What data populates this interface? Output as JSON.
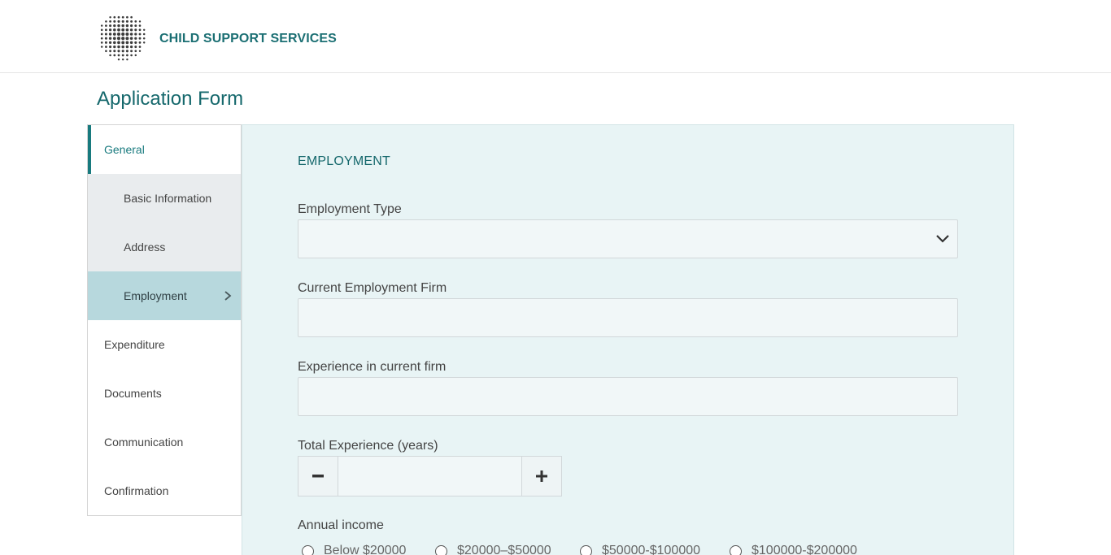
{
  "header": {
    "brand": "CHILD SUPPORT SERVICES",
    "logo_icon": "dotted-sphere-logo",
    "brand_color": "#1b6f73"
  },
  "page": {
    "title": "Application Form"
  },
  "sidebar": {
    "items": [
      {
        "label": "General",
        "state": "active-parent"
      },
      {
        "label": "Basic Information",
        "state": "sub"
      },
      {
        "label": "Address",
        "state": "sub"
      },
      {
        "label": "Employment",
        "state": "active-sub"
      },
      {
        "label": "Expenditure",
        "state": "normal"
      },
      {
        "label": "Documents",
        "state": "normal"
      },
      {
        "label": "Communication",
        "state": "normal"
      },
      {
        "label": "Confirmation",
        "state": "normal"
      }
    ],
    "active_icon": "chevron-right-icon"
  },
  "form": {
    "section_title": "EMPLOYMENT",
    "employment_type": {
      "label": "Employment Type",
      "value": "",
      "icon": "chevron-down-icon"
    },
    "current_firm": {
      "label": "Current Employment Firm",
      "value": ""
    },
    "experience_current": {
      "label": "Experience in current firm",
      "value": ""
    },
    "total_experience": {
      "label": "Total Experience (years)",
      "value": "",
      "minus_icon": "minus-icon",
      "plus_icon": "plus-icon"
    },
    "annual_income": {
      "label": "Annual income",
      "options": [
        "Below $20000",
        "$20000–$50000",
        "$50000-$100000",
        "$100000-$200000"
      ]
    }
  },
  "colors": {
    "accent": "#187a7e",
    "panel_bg": "#e8f4f5",
    "active_sub_bg": "#b7d8dd",
    "sub_bg": "#e9ecee"
  }
}
